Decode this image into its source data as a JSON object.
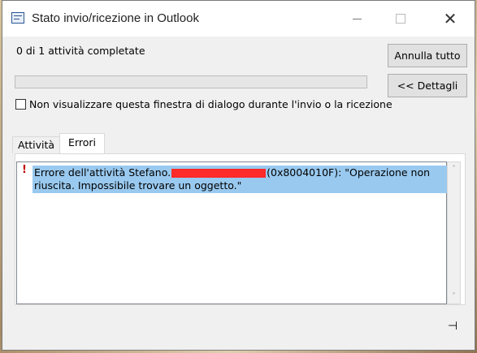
{
  "window": {
    "title": "Stato invio/ricezione in Outlook",
    "minimize_glyph": "",
    "close_glyph": "✕"
  },
  "progress": {
    "status_text": "0 di 1 attività completate",
    "fraction": 0.0
  },
  "buttons": {
    "cancel_all": "Annulla tutto",
    "details": "<< Dettagli"
  },
  "checkbox": {
    "label": "Non visualizzare questa finestra di dialogo durante l'invio o la ricezione",
    "checked": false
  },
  "tabs": [
    {
      "label": "Attività",
      "active": false
    },
    {
      "label": "Errori",
      "active": true
    }
  ],
  "errors": {
    "items": [
      {
        "icon": "!",
        "text_before_redaction": "Errore dell'attività Stefano.",
        "text_after_redaction": "(0x8004010F): \"Operazione non riuscita. Impossibile trovare un oggetto.\""
      }
    ]
  },
  "scrollbar": {
    "up": "˄",
    "down": "˅"
  },
  "pin_glyph": "⊣",
  "colors": {
    "selection": "#99c9ef",
    "error_icon": "#c00000",
    "redaction": "#ff2a2a"
  }
}
